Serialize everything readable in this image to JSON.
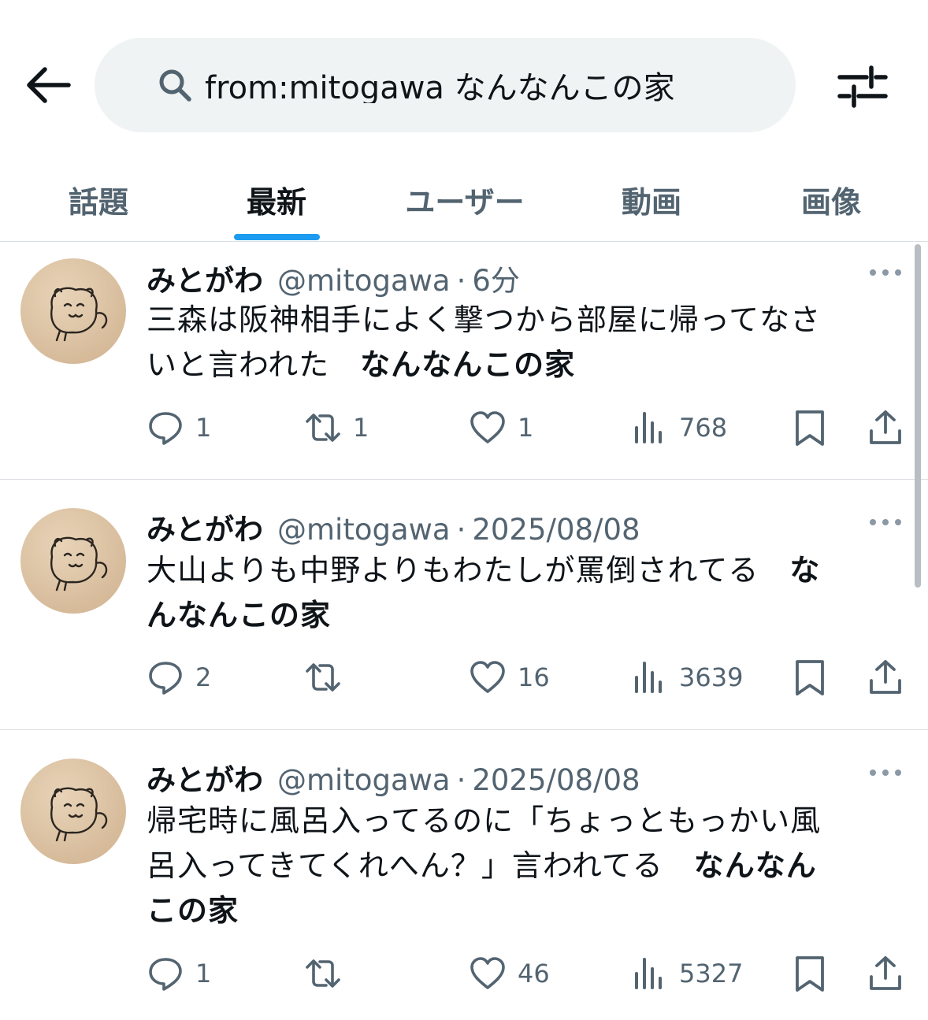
{
  "search": {
    "query": "from:mitogawa なんなんこの家",
    "icon": "search-icon"
  },
  "topbar": {
    "back_icon": "back-arrow-icon",
    "filter_icon": "filter-sliders-icon"
  },
  "tabs": [
    {
      "label": "話題",
      "active": false
    },
    {
      "label": "最新",
      "active": true
    },
    {
      "label": "ユーザー",
      "active": false
    },
    {
      "label": "動画",
      "active": false
    },
    {
      "label": "画像",
      "active": false
    }
  ],
  "tweets": [
    {
      "display_name": "みとがわ",
      "handle": "@mitogawa",
      "separator": "·",
      "time": "6分",
      "lines": [
        {
          "text": "三森は阪神相手によく撃つから部屋に帰ってなさ",
          "bold": ""
        },
        {
          "text": "いと言われた　",
          "bold": "なんなんこの家"
        }
      ],
      "replies": "1",
      "retweets": "1",
      "likes": "1",
      "views": "768"
    },
    {
      "display_name": "みとがわ",
      "handle": "@mitogawa",
      "separator": "·",
      "time": "2025/08/08",
      "lines": [
        {
          "text": "大山よりも中野よりもわたしが罵倒されてる　",
          "bold": "な"
        },
        {
          "text": "",
          "bold": "んなんこの家"
        }
      ],
      "replies": "2",
      "retweets": "",
      "likes": "16",
      "views": "3639"
    },
    {
      "display_name": "みとがわ",
      "handle": "@mitogawa",
      "separator": "·",
      "time": "2025/08/08",
      "lines": [
        {
          "text": "帰宅時に風呂入ってるのに「ちょっともっかい風",
          "bold": ""
        },
        {
          "text": "呂入ってきてくれへん？」言われてる　",
          "bold": "なんなん"
        },
        {
          "text": "",
          "bold": "この家"
        }
      ],
      "replies": "1",
      "retweets": "",
      "likes": "46",
      "views": "5327"
    }
  ],
  "colors": {
    "accent": "#1d9bf0",
    "secondary_text": "#536471",
    "search_bg": "#eff3f4",
    "divider": "#d9dee2"
  }
}
